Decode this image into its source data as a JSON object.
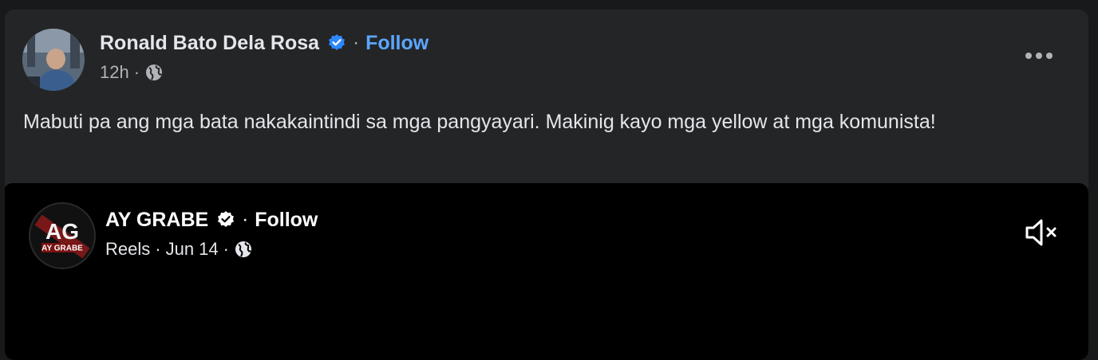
{
  "post": {
    "author_name": "Ronald Bato Dela Rosa",
    "follow_label": "Follow",
    "separator": "·",
    "timestamp": "12h",
    "audience_icon": "globe-icon",
    "text": "Mabuti pa ang mga bata nakakaintindi sa mga pangyayari. Makinig kayo mga yellow at mga komunista!",
    "more_icon": "more-options-icon"
  },
  "shared": {
    "author_name": "AY GRABE",
    "follow_label": "Follow",
    "separator": "·",
    "source": "Reels",
    "date": "Jun 14",
    "audience_icon": "globe-icon",
    "avatar_logo_text": "AG",
    "avatar_logo_subtext": "AY GRABE",
    "mute_icon": "volume-muted-icon"
  },
  "colors": {
    "card_bg": "#242526",
    "page_bg": "#18191a",
    "primary_text": "#e4e6eb",
    "secondary_text": "#b0b3b8",
    "link_blue": "#5aa7ff",
    "verified_blue": "#2d88ff"
  }
}
